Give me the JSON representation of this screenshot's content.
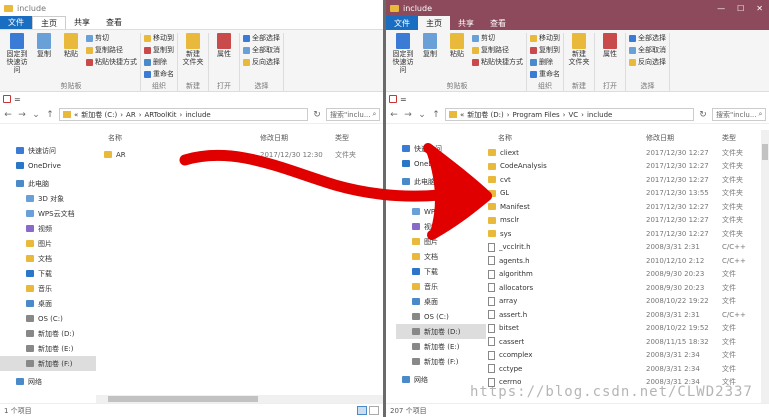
{
  "left": {
    "title": "include",
    "menu": [
      "文件",
      "主页",
      "共享",
      "查看"
    ],
    "ribbon_groups": [
      {
        "title": "剪贴板",
        "big": [
          "固定到\n快速访问",
          "复制",
          "粘贴"
        ],
        "small": [
          "剪切",
          "复制路径",
          "粘贴快捷方式"
        ]
      },
      {
        "title": "组织",
        "big": [],
        "small": [
          "移动到",
          "复制到",
          "删除",
          "重命名"
        ]
      },
      {
        "title": "新建",
        "big": [
          "新建\n文件夹"
        ],
        "small": []
      },
      {
        "title": "打开",
        "big": [
          "属性"
        ],
        "small": []
      },
      {
        "title": "选择",
        "big": [],
        "small": [
          "全部选择",
          "全部取消",
          "反向选择"
        ]
      }
    ],
    "quick_bar": "=",
    "breadcrumb": [
      "«",
      "新加卷 (C:)",
      "AR",
      "ARToolKit",
      "include"
    ],
    "search_placeholder": "搜索\"inclu...",
    "nav": [
      {
        "label": "快速访问",
        "icon": "star-icon",
        "color": "#3a7bd5"
      },
      {
        "label": "OneDrive",
        "icon": "cloud-icon",
        "color": "#2a77c9"
      },
      {
        "label": "此电脑",
        "icon": "computer-icon",
        "color": "#4a8ac8"
      },
      {
        "label": "3D 对象",
        "icon": "cube-icon",
        "color": "#6aa0d8"
      },
      {
        "label": "WPS云文档",
        "icon": "cloud-icon",
        "color": "#6aa0d8"
      },
      {
        "label": "视频",
        "icon": "video-icon",
        "color": "#8a6ac8"
      },
      {
        "label": "图片",
        "icon": "picture-icon",
        "color": "#e8b93a"
      },
      {
        "label": "文档",
        "icon": "document-icon",
        "color": "#e8b93a"
      },
      {
        "label": "下载",
        "icon": "download-icon",
        "color": "#2a77c9"
      },
      {
        "label": "音乐",
        "icon": "music-icon",
        "color": "#e8b93a"
      },
      {
        "label": "桌面",
        "icon": "desktop-icon",
        "color": "#4a8ac8"
      },
      {
        "label": "OS (C:)",
        "icon": "drive-icon",
        "color": "#888888"
      },
      {
        "label": "新加卷 (D:)",
        "icon": "drive-icon",
        "color": "#888888"
      },
      {
        "label": "新加卷 (E:)",
        "icon": "drive-icon",
        "color": "#888888"
      },
      {
        "label": "新加卷 (F:)",
        "icon": "drive-icon",
        "color": "#888888"
      },
      {
        "label": "网络",
        "icon": "network-icon",
        "color": "#4a8ac8"
      }
    ],
    "columns": [
      "名称",
      "修改日期",
      "类型"
    ],
    "files": [
      {
        "name": "AR",
        "date": "2017/12/30 12:30",
        "type": "文件夹"
      }
    ],
    "status": "1 个项目"
  },
  "right": {
    "title": "include",
    "menu": [
      "文件",
      "主页",
      "共享",
      "查看"
    ],
    "ribbon_groups": [
      {
        "title": "剪贴板",
        "big": [
          "固定到\n快速访问",
          "复制",
          "粘贴"
        ],
        "small": [
          "剪切",
          "复制路径",
          "粘贴快捷方式"
        ]
      },
      {
        "title": "组织",
        "big": [],
        "small": [
          "移动到",
          "复制到",
          "删除",
          "重命名"
        ]
      },
      {
        "title": "新建",
        "big": [
          "新建\n文件夹"
        ],
        "small": []
      },
      {
        "title": "打开",
        "big": [
          "属性"
        ],
        "small": []
      },
      {
        "title": "选择",
        "big": [],
        "small": [
          "全部选择",
          "全部取消",
          "反向选择"
        ]
      }
    ],
    "quick_bar": "=",
    "breadcrumb": [
      "«",
      "新加卷 (D:)",
      "Program Files",
      "VC",
      "include"
    ],
    "search_placeholder": "搜索\"inclu...",
    "nav": [
      {
        "label": "快速访问",
        "icon": "star-icon",
        "color": "#3a7bd5"
      },
      {
        "label": "OneDrive",
        "icon": "cloud-icon",
        "color": "#2a77c9"
      },
      {
        "label": "此电脑",
        "icon": "computer-icon",
        "color": "#4a8ac8"
      },
      {
        "label": "3D 对象",
        "icon": "cube-icon",
        "color": "#6aa0d8"
      },
      {
        "label": "WPS云文档",
        "icon": "cloud-icon",
        "color": "#6aa0d8"
      },
      {
        "label": "视频",
        "icon": "video-icon",
        "color": "#8a6ac8"
      },
      {
        "label": "图片",
        "icon": "picture-icon",
        "color": "#e8b93a"
      },
      {
        "label": "文档",
        "icon": "document-icon",
        "color": "#e8b93a"
      },
      {
        "label": "下载",
        "icon": "download-icon",
        "color": "#2a77c9"
      },
      {
        "label": "音乐",
        "icon": "music-icon",
        "color": "#e8b93a"
      },
      {
        "label": "桌面",
        "icon": "desktop-icon",
        "color": "#4a8ac8"
      },
      {
        "label": "OS (C:)",
        "icon": "drive-icon",
        "color": "#888888"
      },
      {
        "label": "新加卷 (D:)",
        "icon": "drive-icon",
        "color": "#888888"
      },
      {
        "label": "新加卷 (E:)",
        "icon": "drive-icon",
        "color": "#888888"
      },
      {
        "label": "新加卷 (F:)",
        "icon": "drive-icon",
        "color": "#888888"
      },
      {
        "label": "网络",
        "icon": "network-icon",
        "color": "#4a8ac8"
      }
    ],
    "columns": [
      "名称",
      "修改日期",
      "类型"
    ],
    "files": [
      {
        "name": "cliext",
        "date": "2017/12/30 12:27",
        "type": "文件夹",
        "kind": "folder"
      },
      {
        "name": "CodeAnalysis",
        "date": "2017/12/30 12:27",
        "type": "文件夹",
        "kind": "folder"
      },
      {
        "name": "cvt",
        "date": "2017/12/30 12:27",
        "type": "文件夹",
        "kind": "folder"
      },
      {
        "name": "GL",
        "date": "2017/12/30 13:55",
        "type": "文件夹",
        "kind": "folder"
      },
      {
        "name": "Manifest",
        "date": "2017/12/30 12:27",
        "type": "文件夹",
        "kind": "folder"
      },
      {
        "name": "msclr",
        "date": "2017/12/30 12:27",
        "type": "文件夹",
        "kind": "folder"
      },
      {
        "name": "sys",
        "date": "2017/12/30 12:27",
        "type": "文件夹",
        "kind": "folder"
      },
      {
        "name": "_vcclrit.h",
        "date": "2008/3/31 2:31",
        "type": "C/C++",
        "kind": "file"
      },
      {
        "name": "agents.h",
        "date": "2010/12/10 2:12",
        "type": "C/C++",
        "kind": "file"
      },
      {
        "name": "algorithm",
        "date": "2008/9/30 20:23",
        "type": "文件",
        "kind": "file"
      },
      {
        "name": "allocators",
        "date": "2008/9/30 20:23",
        "type": "文件",
        "kind": "file"
      },
      {
        "name": "array",
        "date": "2008/10/22 19:22",
        "type": "文件",
        "kind": "file"
      },
      {
        "name": "assert.h",
        "date": "2008/3/31 2:31",
        "type": "C/C++",
        "kind": "file"
      },
      {
        "name": "bitset",
        "date": "2008/10/22 19:52",
        "type": "文件",
        "kind": "file"
      },
      {
        "name": "cassert",
        "date": "2008/11/15 18:32",
        "type": "文件",
        "kind": "file"
      },
      {
        "name": "ccomplex",
        "date": "2008/3/31 2:34",
        "type": "文件",
        "kind": "file"
      },
      {
        "name": "cctype",
        "date": "2008/3/31 2:34",
        "type": "文件",
        "kind": "file"
      },
      {
        "name": "cerrno",
        "date": "2008/3/31 2:34",
        "type": "文件",
        "kind": "file"
      }
    ],
    "status": "207 个项目",
    "controls": [
      "—",
      "☐",
      "✕"
    ]
  },
  "watermark": "https://blog.csdn.net/CLWD2337",
  "colors": {
    "arrow": "#e00000",
    "accent": "#1a6ec1",
    "title_right": "#8c4a5c"
  }
}
